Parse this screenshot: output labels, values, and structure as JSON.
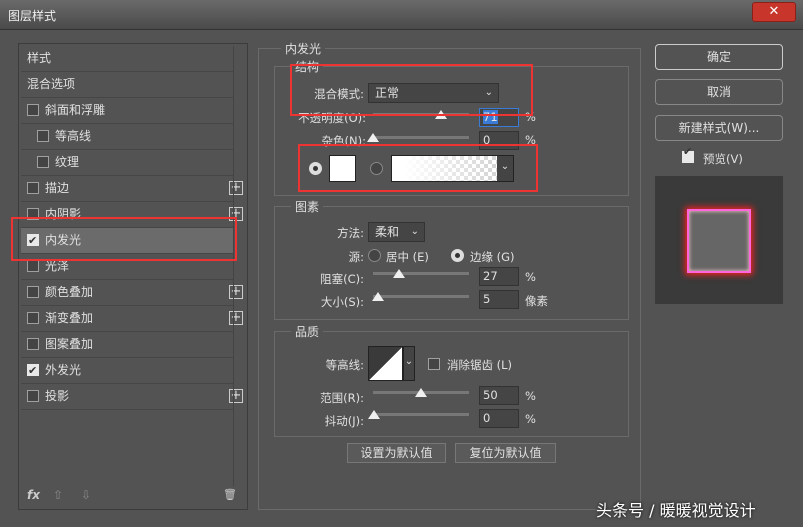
{
  "window": {
    "title": "图层样式",
    "close": "✕"
  },
  "sidebar": {
    "items": [
      {
        "label": "样式"
      },
      {
        "label": "混合选项"
      },
      {
        "label": "斜面和浮雕",
        "checked": false
      },
      {
        "label": "等高线",
        "checked": false
      },
      {
        "label": "纹理",
        "checked": false
      },
      {
        "label": "描边",
        "checked": false
      },
      {
        "label": "内阴影",
        "checked": false
      },
      {
        "label": "内发光",
        "checked": true
      },
      {
        "label": "光泽",
        "checked": false
      },
      {
        "label": "颜色叠加",
        "checked": false
      },
      {
        "label": "渐变叠加",
        "checked": false
      },
      {
        "label": "图案叠加",
        "checked": false
      },
      {
        "label": "外发光",
        "checked": true
      },
      {
        "label": "投影",
        "checked": false
      }
    ],
    "fx": "fx",
    "up": "⇧",
    "down": "⇩",
    "trash": "🗑"
  },
  "panel": {
    "title": "内发光",
    "structure": {
      "title": "结构",
      "blend_label": "混合模式:",
      "blend_value": "正常",
      "opacity_label": "不透明度(O):",
      "opacity_value": "71",
      "opacity_unit": "%",
      "noise_label": "杂色(N):",
      "noise_value": "0",
      "noise_unit": "%"
    },
    "elements": {
      "title": "图素",
      "method_label": "方法:",
      "method_value": "柔和",
      "source_label": "源:",
      "center_label": "居中 (E)",
      "edge_label": "边缘 (G)",
      "choke_label": "阻塞(C):",
      "choke_value": "27",
      "choke_unit": "%",
      "size_label": "大小(S):",
      "size_value": "5",
      "size_unit": "像素"
    },
    "quality": {
      "title": "品质",
      "contour_label": "等高线:",
      "antialias_label": "消除锯齿 (L)",
      "range_label": "范围(R):",
      "range_value": "50",
      "range_unit": "%",
      "jitter_label": "抖动(J):",
      "jitter_value": "0",
      "jitter_unit": "%"
    },
    "set_default": "设置为默认值",
    "reset_default": "复位为默认值"
  },
  "buttons": {
    "ok": "确定",
    "cancel": "取消",
    "new_style": "新建样式(W)...",
    "preview": "预览(V)"
  },
  "watermark": "头条号 / 暖暖视觉设计"
}
